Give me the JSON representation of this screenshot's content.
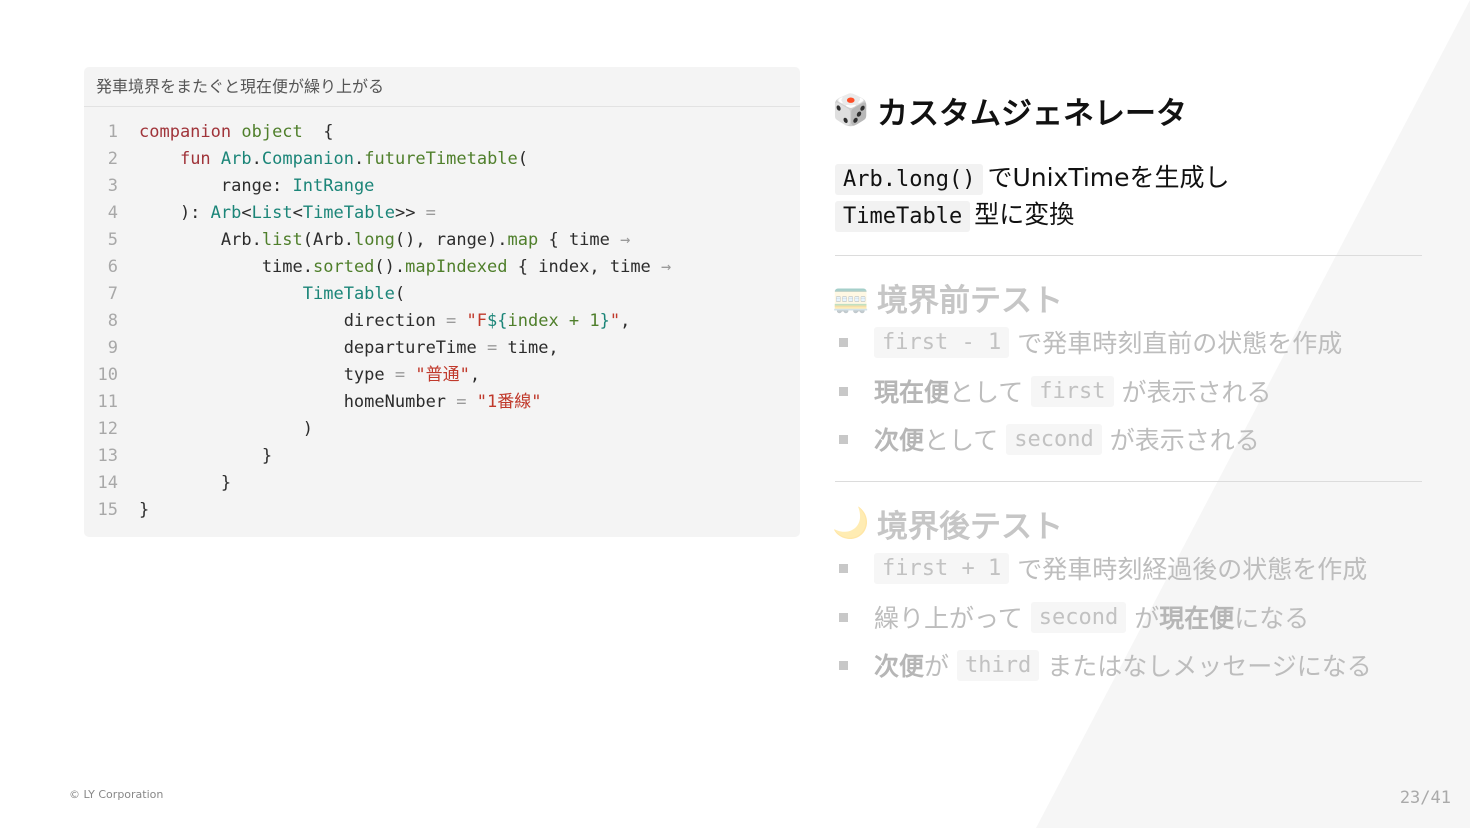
{
  "code": {
    "caption": "発車境界をまたぐと現在便が繰り上がる",
    "lines": [
      [
        "1",
        [
          [
            "kw",
            "companion "
          ],
          [
            "fn",
            "object"
          ],
          [
            "",
            "  {"
          ]
        ]
      ],
      [
        "2",
        [
          [
            "",
            "    "
          ],
          [
            "kw",
            "fun "
          ],
          [
            "ty",
            "Arb"
          ],
          [
            "",
            "."
          ],
          [
            "ty",
            "Companion"
          ],
          [
            "",
            "."
          ],
          [
            "fn",
            "futureTimetable"
          ],
          [
            "",
            "("
          ]
        ]
      ],
      [
        "3",
        [
          [
            "",
            "        range: "
          ],
          [
            "ty",
            "IntRange"
          ]
        ]
      ],
      [
        "4",
        [
          [
            "",
            "    ): "
          ],
          [
            "ty",
            "Arb"
          ],
          [
            "",
            "<"
          ],
          [
            "ty",
            "List"
          ],
          [
            "",
            "<"
          ],
          [
            "ty",
            "TimeTable"
          ],
          [
            "",
            ">>"
          ],
          [
            "op",
            " ="
          ]
        ]
      ],
      [
        "5",
        [
          [
            "",
            "        Arb."
          ],
          [
            "fn",
            "list"
          ],
          [
            "",
            "(Arb."
          ],
          [
            "fn",
            "long"
          ],
          [
            "",
            "(), range)."
          ],
          [
            "fn",
            "map"
          ],
          [
            "",
            " { time "
          ],
          [
            "op",
            "→"
          ]
        ]
      ],
      [
        "6",
        [
          [
            "",
            "            time."
          ],
          [
            "fn",
            "sorted"
          ],
          [
            "",
            "()."
          ],
          [
            "fn",
            "mapIndexed"
          ],
          [
            "",
            " { index, time "
          ],
          [
            "op",
            "→"
          ]
        ]
      ],
      [
        "7",
        [
          [
            "",
            "                "
          ],
          [
            "ty",
            "TimeTable"
          ],
          [
            "",
            "("
          ]
        ]
      ],
      [
        "8",
        [
          [
            "",
            "                    direction "
          ],
          [
            "op",
            "="
          ],
          [
            "st",
            " \"F"
          ],
          [
            "ty",
            "${"
          ],
          [
            "fn",
            "index + 1"
          ],
          [
            "ty",
            "}"
          ],
          [
            "st",
            "\""
          ],
          [
            "",
            ","
          ]
        ]
      ],
      [
        "9",
        [
          [
            "",
            "                    departureTime "
          ],
          [
            "op",
            "="
          ],
          [
            "",
            " time,"
          ]
        ]
      ],
      [
        "10",
        [
          [
            "",
            "                    type "
          ],
          [
            "op",
            "="
          ],
          [
            "st",
            " \"普通\""
          ],
          [
            "",
            ","
          ]
        ]
      ],
      [
        "11",
        [
          [
            "",
            "                    homeNumber "
          ],
          [
            "op",
            "="
          ],
          [
            "st",
            " \"1番線\""
          ]
        ]
      ],
      [
        "12",
        [
          [
            "",
            "                )"
          ]
        ]
      ],
      [
        "13",
        [
          [
            "",
            "            }"
          ]
        ]
      ],
      [
        "14",
        [
          [
            "",
            "        }"
          ]
        ]
      ],
      [
        "15",
        [
          [
            "",
            "}"
          ]
        ]
      ]
    ]
  },
  "right": {
    "heading1": "カスタムジェネレータ",
    "heading1_icon": "die-icon",
    "desc1_code": "Arb.long()",
    "desc1_text": "でUnixTimeを生成し",
    "desc2_code": "TimeTable",
    "desc2_text": "型に変換",
    "heading2": "境界前テスト",
    "heading2_icon": "train-icon",
    "before": [
      {
        "code": "first - 1",
        "text": "で発車時刻直前の状態を作成"
      },
      {
        "bold": "現在便",
        "mid": "として",
        "code": "first",
        "text": "が表示される"
      },
      {
        "bold": "次便",
        "mid": "として",
        "code": "second",
        "text": "が表示される"
      }
    ],
    "heading3": "境界後テスト",
    "heading3_icon": "moon-icon",
    "after": [
      {
        "code": "first + 1",
        "text": "で発車時刻経過後の状態を作成"
      },
      {
        "pre": "繰り上がって",
        "code": "second",
        "mid": "が",
        "bold": "現在便",
        "text": "になる"
      },
      {
        "bold": "次便",
        "mid": "が",
        "code": "third",
        "text": "またはなしメッセージになる"
      }
    ]
  },
  "footer": {
    "copyright": "© LY Corporation",
    "page": "23/41"
  }
}
